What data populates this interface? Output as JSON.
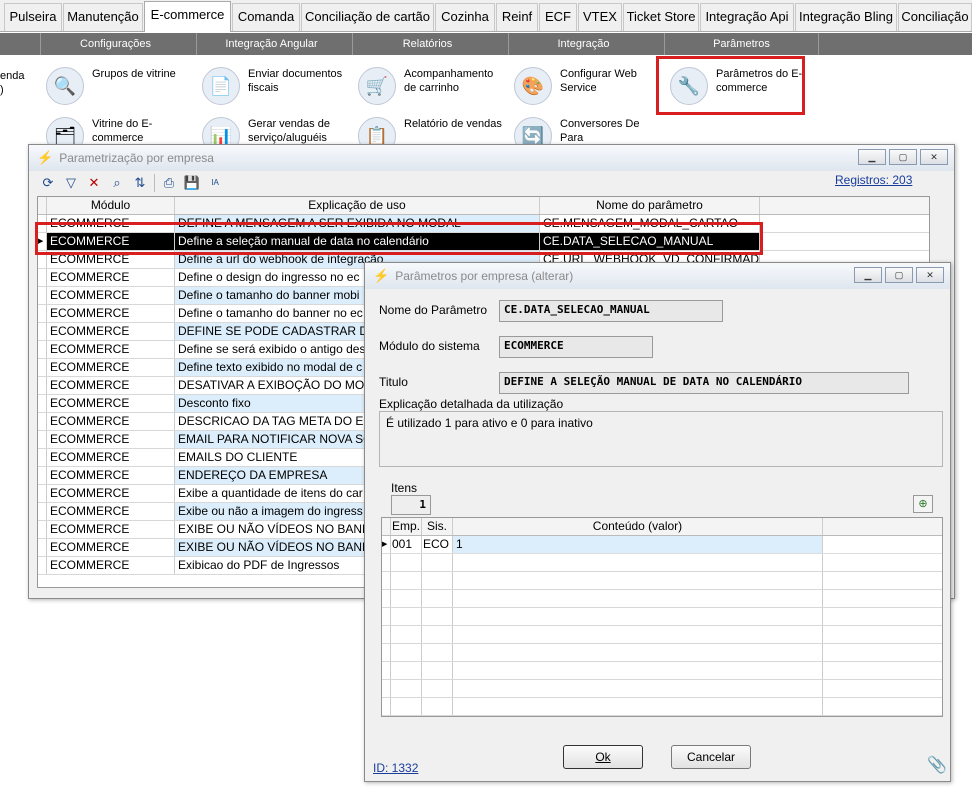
{
  "top_tabs": [
    "Pulseira",
    "Manutenção",
    "E-commerce",
    "Comanda",
    "Conciliação de cartão",
    "Cozinha",
    "Reinf",
    "ECF",
    "VTEX",
    "Ticket Store",
    "Integração Api",
    "Integração Bling",
    "Conciliação"
  ],
  "active_tab": "E-commerce",
  "sub_menu": [
    "Configurações",
    "Integração Angular",
    "Relatórios",
    "Integração",
    "Parâmetros"
  ],
  "ribbon": {
    "partial_left": "enda\n)",
    "items": [
      {
        "label": "Grupos de vitrine",
        "icon": "magnifier-icon"
      },
      {
        "label": "Enviar documentos fiscais",
        "icon": "document-send-icon"
      },
      {
        "label": "Acompanhamento de carrinho",
        "icon": "cart-icon"
      },
      {
        "label": "Configurar Web Service",
        "icon": "web-service-icon"
      },
      {
        "label": "Parâmetros do E-commerce",
        "icon": "tools-icon"
      },
      {
        "label": "Vitrine do E-commerce",
        "icon": "showcase-icon"
      },
      {
        "label": "Gerar vendas de serviço/aluguéis",
        "icon": "sales-icon"
      },
      {
        "label": "Relatório de vendas",
        "icon": "report-icon"
      },
      {
        "label": "Conversores De Para",
        "icon": "converter-icon"
      }
    ]
  },
  "param_window": {
    "title": "Parametrização por empresa",
    "records_link": "Registros: 203",
    "columns": [
      "Módulo",
      "Explicação de uso",
      "Nome do parâmetro"
    ],
    "rows": [
      {
        "module": "ECOMMERCE",
        "explanation": "DEFINE A MENSAGEM A SER EXIBIDA NO MODAL",
        "name": "CE.MENSAGEM_MODAL_CARTAO"
      },
      {
        "module": "ECOMMERCE",
        "explanation": "Define a seleção manual de data no calendário",
        "name": "CE.DATA_SELECAO_MANUAL",
        "selected": true
      },
      {
        "module": "ECOMMERCE",
        "explanation": "Define a url do webhook de integração",
        "name": "CE.URL_WEBHOOK_VD_CONFIRMADA"
      },
      {
        "module": "ECOMMERCE",
        "explanation": "Define o design do ingresso no ec",
        "name": ""
      },
      {
        "module": "ECOMMERCE",
        "explanation": "Define o tamanho do banner mobi",
        "name": ""
      },
      {
        "module": "ECOMMERCE",
        "explanation": "Define o tamanho do banner no ec",
        "name": ""
      },
      {
        "module": "ECOMMERCE",
        "explanation": "DEFINE SE PODE CADASTRAR D",
        "name": ""
      },
      {
        "module": "ECOMMERCE",
        "explanation": "Define se será exibido o antigo des",
        "name": ""
      },
      {
        "module": "ECOMMERCE",
        "explanation": "Define texto exibido no modal de c",
        "name": ""
      },
      {
        "module": "ECOMMERCE",
        "explanation": "DESATIVAR A EXIBOÇÃO DO MOD",
        "name": ""
      },
      {
        "module": "ECOMMERCE",
        "explanation": "Desconto fixo",
        "name": ""
      },
      {
        "module": "ECOMMERCE",
        "explanation": "DESCRICAO DA TAG META DO EC",
        "name": ""
      },
      {
        "module": "ECOMMERCE",
        "explanation": "EMAIL PARA NOTIFICAR NOVA SO",
        "name": ""
      },
      {
        "module": "ECOMMERCE",
        "explanation": "EMAILS DO CLIENTE",
        "name": ""
      },
      {
        "module": "ECOMMERCE",
        "explanation": "ENDEREÇO DA EMPRESA",
        "name": ""
      },
      {
        "module": "ECOMMERCE",
        "explanation": "Exibe a quantidade de itens do car",
        "name": ""
      },
      {
        "module": "ECOMMERCE",
        "explanation": "Exibe ou não a imagem do ingress",
        "name": ""
      },
      {
        "module": "ECOMMERCE",
        "explanation": "EXIBE OU NÃO VÍDEOS NO BANNE",
        "name": ""
      },
      {
        "module": "ECOMMERCE",
        "explanation": "EXIBE OU NÃO VÍDEOS NO BANNE",
        "name": ""
      },
      {
        "module": "ECOMMERCE",
        "explanation": "Exibicao do PDF de Ingressos",
        "name": ""
      }
    ]
  },
  "edit_window": {
    "title": "Parâmetros por empresa (alterar)",
    "param_name_label": "Nome do Parâmetro",
    "param_name_value": "CE.DATA_SELECAO_MANUAL",
    "module_label": "Módulo do sistema",
    "module_value": "ECOMMERCE",
    "title_label": "Titulo",
    "title_value": "DEFINE A SELEÇÃO MANUAL DE DATA NO CALENDÁRIO",
    "detail_label": "Explicação detalhada da utilização",
    "detail_value": "É utilizado 1 para ativo e 0 para inativo",
    "items_label": "Itens",
    "items_count": "1",
    "items_columns": [
      "Emp.",
      "Sis.",
      "Conteúdo (valor)"
    ],
    "items_rows": [
      {
        "emp": "001",
        "sis": "ECO",
        "value": "1"
      }
    ],
    "ok_label": "Ok",
    "cancel_label": "Cancelar",
    "id_link": "ID: 1332"
  }
}
